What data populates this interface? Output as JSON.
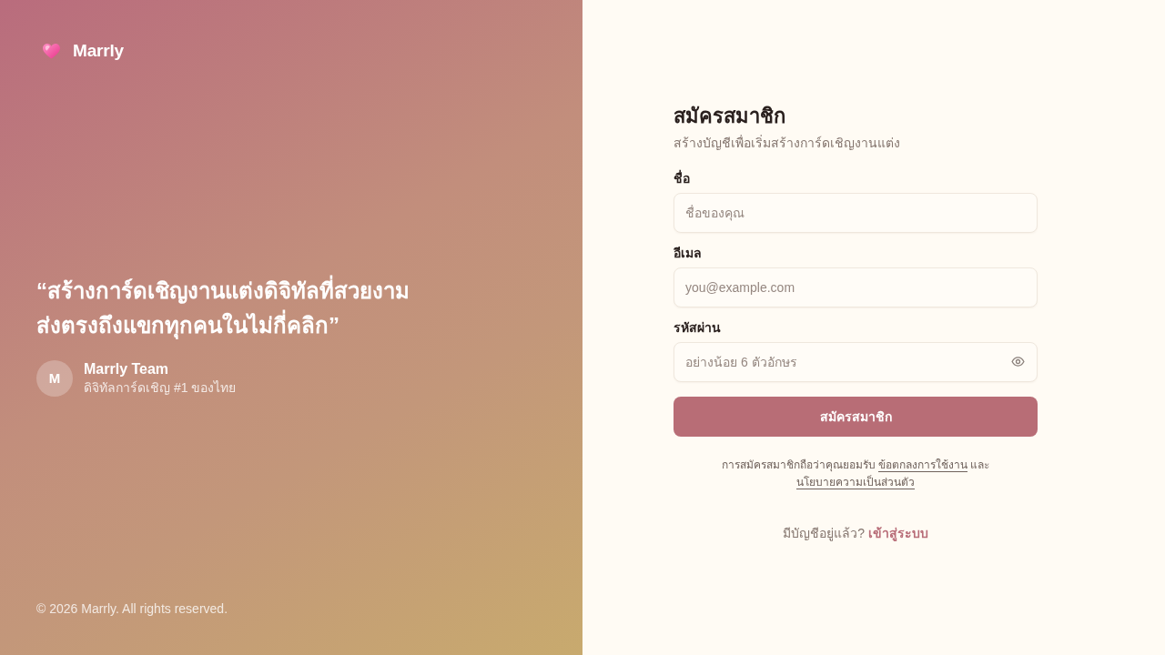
{
  "brand": {
    "name": "Marrly"
  },
  "hero": {
    "quote_lines": [
      "“สร้างการ์ดเชิญงานแต่งดิจิทัลที่สวยงาม",
      "ส่งตรงถึงแขกทุกคนในไม่กี่คลิก”"
    ],
    "author": {
      "initial": "M",
      "name": "Marrly Team",
      "tagline": "ดิจิทัลการ์ดเชิญ #1 ของไทย"
    }
  },
  "footer": "© 2026 Marrly. All rights reserved.",
  "form": {
    "title": "สมัครสมาชิก",
    "subtitle": "สร้างบัญชีเพื่อเริ่มสร้างการ์ดเชิญงานแต่ง",
    "fields": [
      {
        "kind": "text",
        "label": "ชื่อ",
        "placeholder": "ชื่อของคุณ"
      },
      {
        "kind": "email",
        "label": "อีเมล",
        "placeholder": "you@example.com"
      },
      {
        "kind": "password",
        "label": "รหัสผ่าน",
        "placeholder": "อย่างน้อย 6 ตัวอักษร"
      }
    ],
    "submit": "สมัครสมาชิก",
    "terms": [
      {
        "kind": "text",
        "text": "การสมัครสมาชิกถือว่าคุณยอมรับ"
      },
      {
        "kind": "link",
        "text": "ข้อตกลงการใช้งาน"
      },
      {
        "kind": "text",
        "text": "และ"
      },
      {
        "kind": "link",
        "text": "นโยบายความเป็นส่วนตัว"
      }
    ],
    "login_prompt": {
      "text": "มีบัญชีอยู่แล้ว?",
      "link": "เข้าสู่ระบบ"
    }
  }
}
